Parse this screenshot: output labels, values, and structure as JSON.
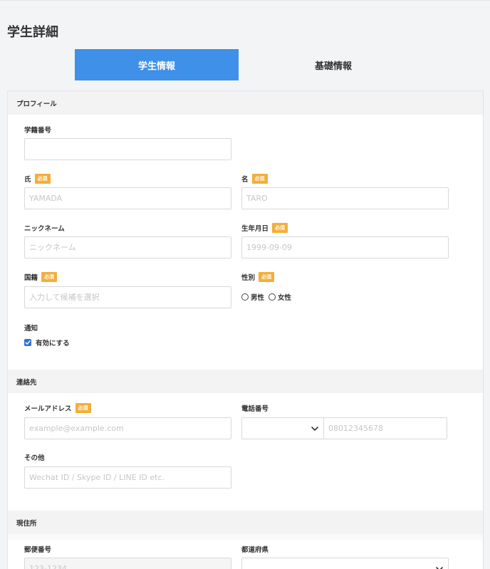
{
  "page_title": "学生詳細",
  "tabs": [
    {
      "label": "学生情報",
      "active": true
    },
    {
      "label": "基礎情報",
      "active": false
    }
  ],
  "required_badge": "必須",
  "colors": {
    "accent": "#3e90e8",
    "required": "#f3ae3a",
    "checkbox": "#2f73d6"
  },
  "profile": {
    "header": "プロフィール",
    "student_number": {
      "label": "学籍番号",
      "value": "",
      "placeholder": ""
    },
    "last_name": {
      "label": "氏",
      "placeholder": "YAMADA"
    },
    "first_name": {
      "label": "名",
      "placeholder": "TARO"
    },
    "nickname": {
      "label": "ニックネーム",
      "placeholder": "ニックネーム"
    },
    "birthdate": {
      "label": "生年月日",
      "placeholder": "1999-09-09"
    },
    "nationality": {
      "label": "国籍",
      "placeholder": "入力して候補を選択"
    },
    "gender": {
      "label": "性別",
      "options": [
        "男性",
        "女性"
      ],
      "selected": null
    },
    "notification": {
      "label": "通知",
      "checkbox_label": "有効にする",
      "checked": true
    }
  },
  "contact": {
    "header": "連絡先",
    "email": {
      "label": "メールアドレス",
      "placeholder": "example@example.com"
    },
    "phone": {
      "label": "電話番号",
      "country_code": "",
      "placeholder": "08012345678"
    },
    "other": {
      "label": "その他",
      "placeholder": "Wechat ID / Skype ID / LINE ID etc."
    }
  },
  "address": {
    "header": "現住所",
    "postal_code": {
      "label": "郵便番号",
      "placeholder": "123-1234"
    },
    "prefecture": {
      "label": "都道府県",
      "value": ""
    }
  }
}
